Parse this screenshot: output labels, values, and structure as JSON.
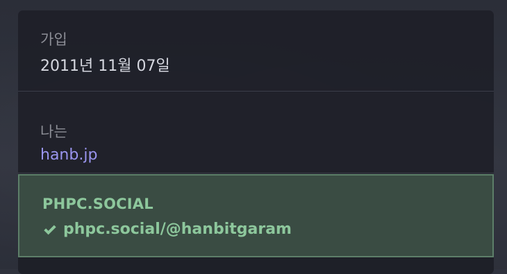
{
  "profile_fields": {
    "joined": {
      "label": "가입",
      "value": "2011년 11월 07일"
    },
    "about_me": {
      "label": "나는",
      "value": "hanb.jp"
    },
    "verified": {
      "label": "PHPC.SOCIAL",
      "value": "phpc.social/@hanbitgaram",
      "icon": "check-icon"
    }
  },
  "colors": {
    "panel_bg": "#1e2028",
    "verified_bg": "#3a4c43",
    "verified_text": "#8dc79c",
    "link_color": "#9a95ef",
    "label_color": "#8c8e96"
  }
}
